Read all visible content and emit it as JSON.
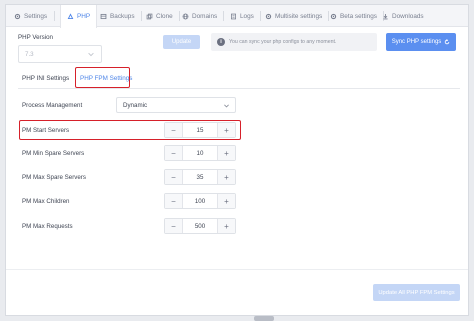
{
  "tabs": [
    {
      "label": "Settings",
      "icon": "gear-icon"
    },
    {
      "label": "PHP",
      "icon": "php-icon",
      "active": true
    },
    {
      "label": "Backups",
      "icon": "backup-icon"
    },
    {
      "label": "Clone",
      "icon": "clone-icon"
    },
    {
      "label": "Domains",
      "icon": "globe-icon"
    },
    {
      "label": "Logs",
      "icon": "document-icon"
    },
    {
      "label": "Multisite settings",
      "icon": "gear-icon"
    },
    {
      "label": "Beta settings",
      "icon": "gear-icon"
    },
    {
      "label": "Downloads",
      "icon": "download-icon"
    }
  ],
  "php": {
    "version_label": "PHP Version",
    "version_value": "7.3",
    "update_label": "Update",
    "info_text": "You can sync your php configs to any moment.",
    "sync_label": "Sync PHP settings"
  },
  "subtabs": {
    "ini": "PHP INI Settings",
    "fpm": "PHP FPM Settings"
  },
  "form": {
    "process_management_label": "Process Management",
    "process_management_value": "Dynamic",
    "rows": [
      {
        "label": "PM Start Servers",
        "value": "15"
      },
      {
        "label": "PM Min Spare Servers",
        "value": "10"
      },
      {
        "label": "PM Max Spare Servers",
        "value": "35"
      },
      {
        "label": "PM Max Children",
        "value": "100"
      },
      {
        "label": "PM Max Requests",
        "value": "500"
      }
    ],
    "minus": "−",
    "plus": "+"
  },
  "footer": {
    "update_all_label": "Update All PHP FPM Settings"
  },
  "colors": {
    "accent": "#5b8ff0",
    "highlight": "#d6202a",
    "disabled_button": "#c4d6f6"
  }
}
